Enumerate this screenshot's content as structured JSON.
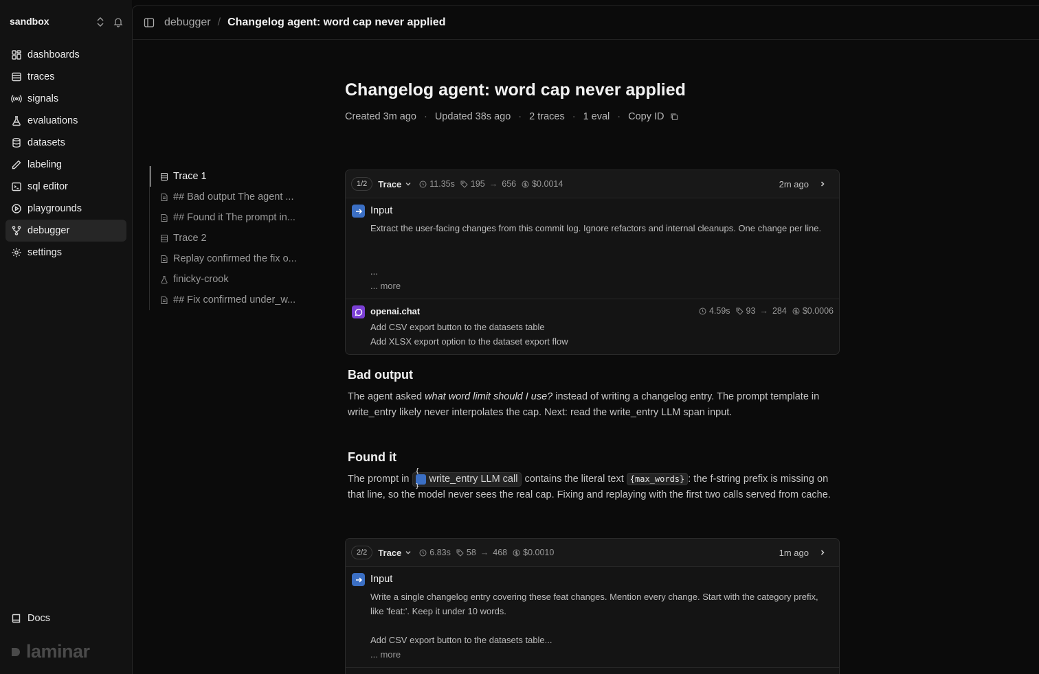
{
  "sidebar": {
    "workspace": "sandbox",
    "items": [
      {
        "label": "dashboards",
        "icon": "grid-icon"
      },
      {
        "label": "traces",
        "icon": "list-icon"
      },
      {
        "label": "signals",
        "icon": "signal-icon"
      },
      {
        "label": "evaluations",
        "icon": "flask-icon"
      },
      {
        "label": "datasets",
        "icon": "database-icon"
      },
      {
        "label": "labeling",
        "icon": "pencil-icon"
      },
      {
        "label": "sql editor",
        "icon": "terminal-icon"
      },
      {
        "label": "playgrounds",
        "icon": "play-icon"
      },
      {
        "label": "debugger",
        "icon": "branch-icon",
        "active": true
      },
      {
        "label": "settings",
        "icon": "gear-icon"
      }
    ],
    "docs": "Docs",
    "logo_text": "laminar"
  },
  "breadcrumb": {
    "parent": "debugger",
    "separator": "/",
    "current": "Changelog agent: word cap never applied"
  },
  "page": {
    "title": "Changelog agent: word cap never applied",
    "meta": {
      "created": "Created 3m ago",
      "updated": "Updated 38s ago",
      "traces": "2 traces",
      "evals": "1 eval",
      "copy_id": "Copy ID",
      "sep": "·"
    }
  },
  "toc": [
    {
      "label": "Trace 1",
      "icon": "trace-icon",
      "active": true
    },
    {
      "label": "## Bad output The agent ...",
      "icon": "note-icon"
    },
    {
      "label": "## Found it The prompt in...",
      "icon": "note-icon"
    },
    {
      "label": "Trace 2",
      "icon": "trace-icon"
    },
    {
      "label": "Replay confirmed the fix o...",
      "icon": "note-icon"
    },
    {
      "label": "finicky-crook",
      "icon": "flask-icon"
    },
    {
      "label": "## Fix confirmed under_w...",
      "icon": "note-icon"
    }
  ],
  "trace1": {
    "index": "1/2",
    "label": "Trace",
    "duration": "11.35s",
    "tokens_in": "195",
    "tokens_out": "656",
    "cost": "$0.0014",
    "ago": "2m ago",
    "input": {
      "title": "Input",
      "text": "Extract the user-facing changes from this commit log. Ignore refactors and internal cleanups. One change per line.\n\n\n...",
      "more": "... more"
    },
    "llm": {
      "title": "openai.chat",
      "duration": "4.59s",
      "tokens_in": "93",
      "tokens_out": "284",
      "cost": "$0.0006",
      "text": "Add CSV export button to the datasets table\nAdd XLSX export option to the dataset export flow"
    }
  },
  "note1": {
    "heading": "Bad output",
    "p1": "The agent asked ",
    "em": "what word limit should I use?",
    "p2": " instead of writing a changelog entry. The prompt template in write_entry likely never interpolates the cap. Next: read the write_entry LLM span input."
  },
  "note2": {
    "heading": "Found it",
    "p1": "The prompt in ",
    "chip_icon": "{ }",
    "chip": "write_entry LLM call",
    "p2": " contains the literal text ",
    "code": "{max_words}",
    "p3": ": the f-string prefix is missing on that line, so the model never sees the real cap. Fixing and replaying with the first two calls served from cache."
  },
  "trace2": {
    "index": "2/2",
    "label": "Trace",
    "duration": "6.83s",
    "tokens_in": "58",
    "tokens_out": "468",
    "cost": "$0.0010",
    "ago": "1m ago",
    "input": {
      "title": "Input",
      "text": "Write a single changelog entry covering these feat changes. Mention every change. Start with the category prefix, like 'feat:'. Keep it under 10 words.\n\nAdd CSV export button to the datasets table...",
      "more": "... more"
    }
  },
  "colors": {
    "accent_blue": "#3b6fc4",
    "llm_purple": "#7a3fd4",
    "background": "#0a0a0a"
  }
}
